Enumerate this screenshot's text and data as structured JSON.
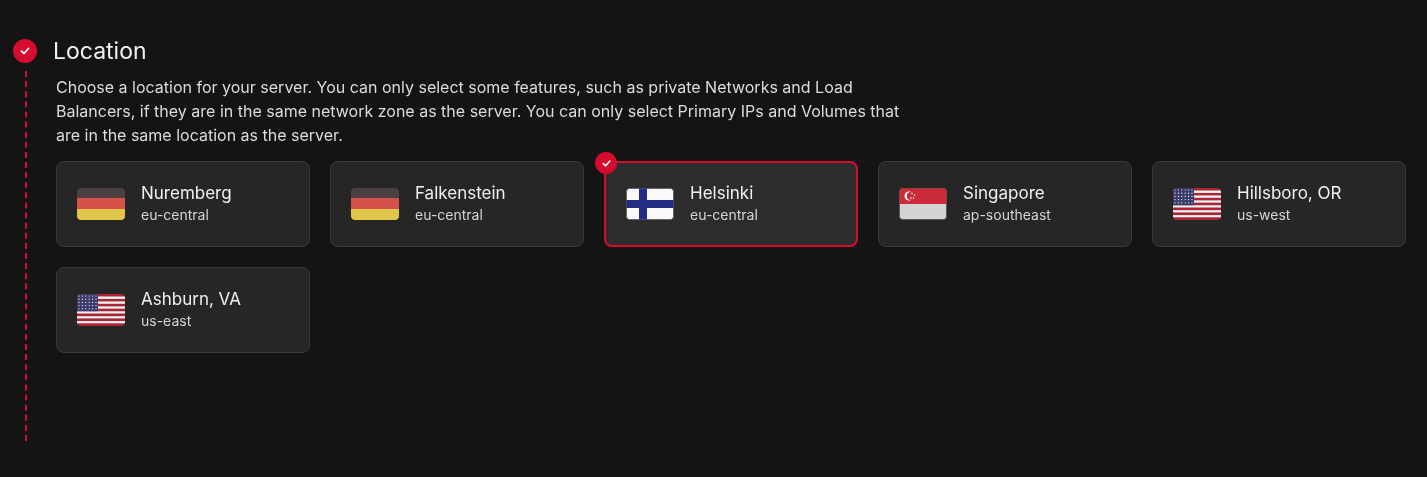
{
  "section": {
    "title": "Location",
    "completed": true,
    "description": "Choose a location for your server. You can only select some features, such as private Networks and Load Balancers, if they are in the same network zone as the server. You can only select Primary IPs and Volumes that are in the same location as the server."
  },
  "locations": [
    {
      "name": "Nuremberg",
      "zone": "eu-central",
      "kind": "de",
      "selected": false
    },
    {
      "name": "Falkenstein",
      "zone": "eu-central",
      "kind": "de",
      "selected": false
    },
    {
      "name": "Helsinki",
      "zone": "eu-central",
      "kind": "fi",
      "selected": true
    },
    {
      "name": "Singapore",
      "zone": "ap-southeast",
      "kind": "sg",
      "selected": false
    },
    {
      "name": "Hillsboro, OR",
      "zone": "us-west",
      "kind": "us",
      "selected": false
    },
    {
      "name": "Ashburn, VA",
      "zone": "us-east",
      "kind": "us",
      "selected": false
    }
  ]
}
